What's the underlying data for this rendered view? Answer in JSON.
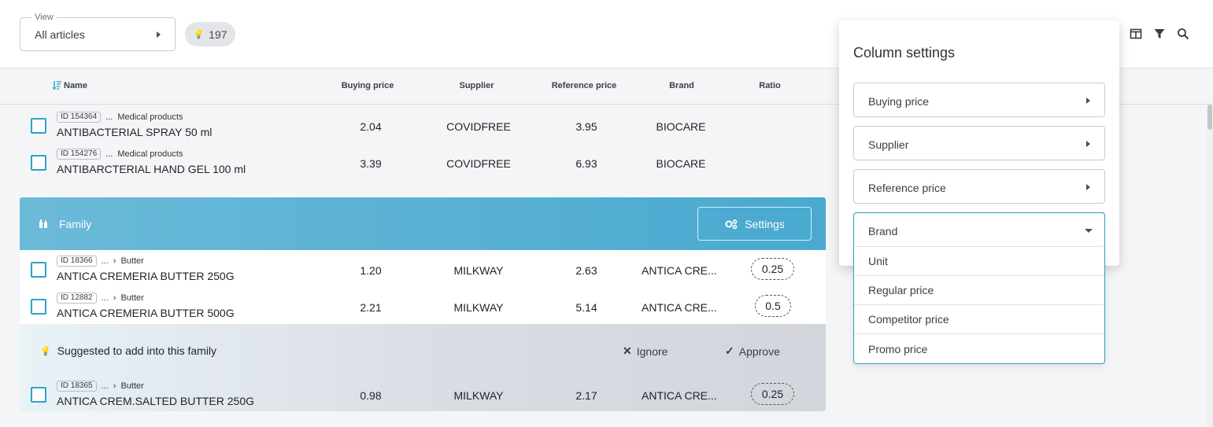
{
  "toolbar": {
    "view_label": "View",
    "view_value": "All articles",
    "count": "197",
    "icons": [
      "columns-icon",
      "filter-icon",
      "search-icon"
    ]
  },
  "columns": {
    "name": "Name",
    "buying_price": "Buying price",
    "supplier": "Supplier",
    "reference_price": "Reference price",
    "brand": "Brand",
    "ratio": "Ratio"
  },
  "rows_top": [
    {
      "id": "ID 154364",
      "path": "...",
      "category": "Medical products",
      "name": "ANTIBACTERIAL SPRAY 50 ml",
      "buying_price": "2.04",
      "supplier": "COVIDFREE",
      "reference_price": "3.95",
      "brand": "BIOCARE",
      "ratio": ""
    },
    {
      "id": "ID 154276",
      "path": "...",
      "category": "Medical products",
      "name": "ANTIBARCTERIAL HAND GEL 100 ml",
      "buying_price": "3.39",
      "supplier": "COVIDFREE",
      "reference_price": "6.93",
      "brand": "BIOCARE",
      "ratio": ""
    }
  ],
  "family": {
    "label": "Family",
    "settings_label": "Settings"
  },
  "rows_family": [
    {
      "id": "ID 18366",
      "path": "...",
      "category": "Butter",
      "name": "ANTICA CREMERIA BUTTER 250G",
      "buying_price": "1.20",
      "supplier": "MILKWAY",
      "reference_price": "2.63",
      "brand": "ANTICA CRE...",
      "ratio": "0.25"
    },
    {
      "id": "ID 12882",
      "path": "...",
      "category": "Butter",
      "name": "ANTICA CREMERIA BUTTER 500G",
      "buying_price": "2.21",
      "supplier": "MILKWAY",
      "reference_price": "5.14",
      "brand": "ANTICA CRE...",
      "ratio": "0.5"
    }
  ],
  "suggestion": {
    "text": "Suggested to add into this family",
    "ignore_label": "Ignore",
    "approve_label": "Approve",
    "row": {
      "id": "ID 18365",
      "path": "...",
      "category": "Butter",
      "name": "ANTICA CREM.SALTED BUTTER 250G",
      "buying_price": "0.98",
      "supplier": "MILKWAY",
      "reference_price": "2.17",
      "brand": "ANTICA CRE...",
      "ratio": "0.25"
    }
  },
  "column_settings": {
    "title": "Column settings",
    "fields": [
      "Buying price",
      "Supplier",
      "Reference price"
    ],
    "active_field": "Brand",
    "options": [
      "Unit",
      "Regular price",
      "Competitor price",
      "Promo price"
    ]
  },
  "colors": {
    "accent": "#2ba3c7",
    "family_bar": "#4faad0"
  }
}
